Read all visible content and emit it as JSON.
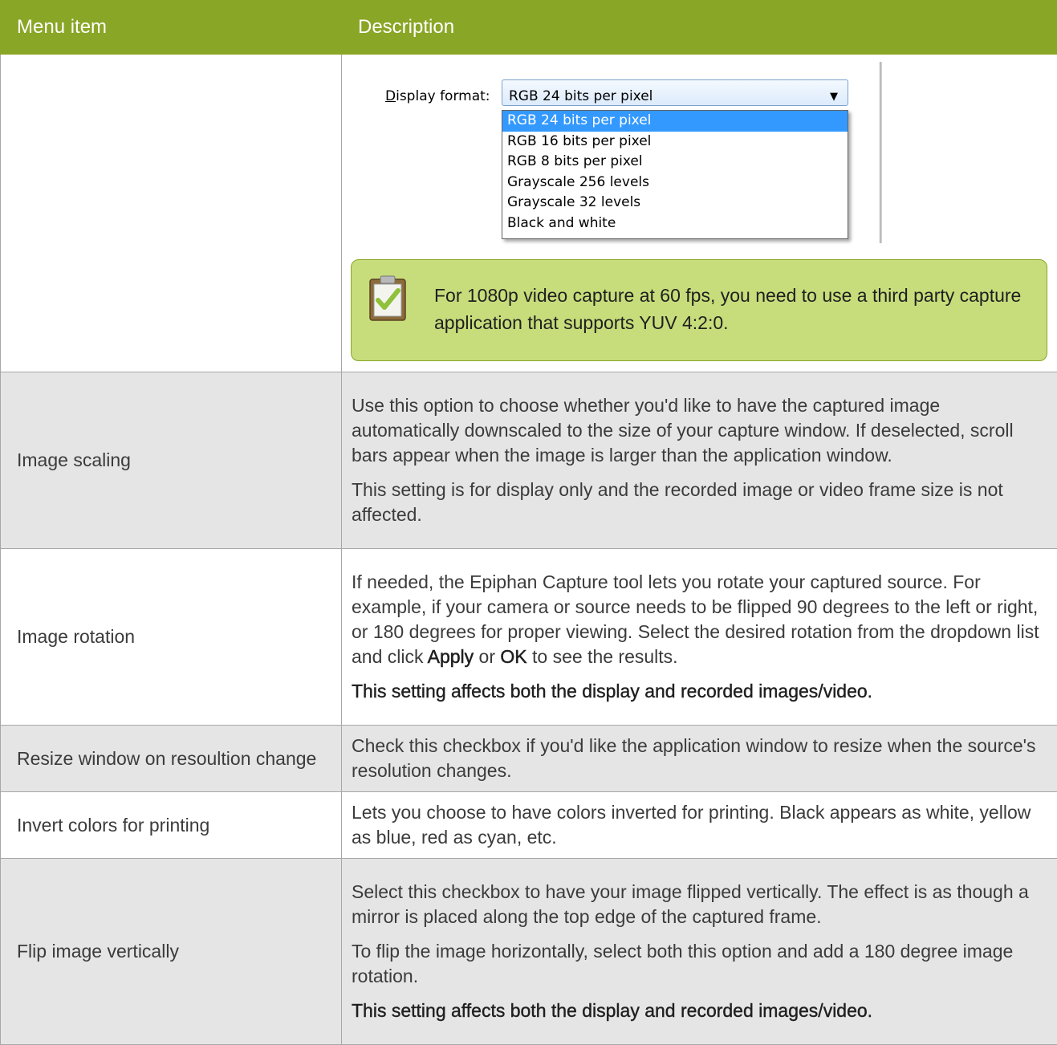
{
  "table": {
    "headers": [
      "Menu item",
      "Description"
    ],
    "first_row": {
      "screenshot": {
        "label_prefix": "D",
        "label_rest": "isplay format:",
        "selected_value": "RGB 24 bits per pixel",
        "options": [
          "RGB 24 bits per pixel",
          "RGB 16 bits per pixel",
          "RGB 8 bits per pixel",
          "Grayscale 256 levels",
          "Grayscale 32 levels",
          "Black and white"
        ]
      },
      "note": "For 1080p video capture at 60 fps, you need to use a third party capture application that supports YUV 4:2:0."
    },
    "rows": {
      "image_scaling": {
        "item": "Image scaling",
        "p1": "Use this option to choose whether you'd like to have the captured image automatically downscaled to the size of your capture window. If deselected, scroll bars appear when the image is larger than the application window.",
        "p2": "This setting is for display only and the recorded image or video frame size is not affected."
      },
      "image_rotation": {
        "item": "Image rotation",
        "p1_before": "If needed, the Epiphan Capture tool lets you rotate your captured source. For example, if your camera or source needs to be flipped 90 degrees to the left or right, or 180 degrees for proper viewing. Select the desired rotation from the dropdown list and click ",
        "kw_apply": "Apply",
        "or": " or ",
        "kw_ok": "OK",
        "p1_after": " to see the results.",
        "p2": "This setting affects both the display and recorded images/video."
      },
      "resize_window": {
        "item": "Resize window on resoultion change",
        "p1": "Check this checkbox if you'd like the application window to resize when the source's resolution changes."
      },
      "invert_colors": {
        "item": "Invert colors for printing",
        "p1": "Lets you choose to have colors inverted for printing. Black appears as white, yellow as blue, red as cyan, etc."
      },
      "flip_vertical": {
        "item": "Flip image vertically",
        "p1": "Select this checkbox to have your image flipped vertically. The effect is as though a mirror is placed along the top edge of the captured frame.",
        "p2": "To flip the image horizontally, select both this option and add a 180 degree image rotation.",
        "p3": "This setting affects both the display and recorded images/video."
      }
    }
  },
  "colors": {
    "header_bg": "#8aa626",
    "note_bg": "#c7dd7b",
    "row_shade": "#e5e5e5",
    "list_selected": "#3399ff"
  },
  "icons": [
    "clipboard-check-icon",
    "dropdown-arrow-icon"
  ]
}
